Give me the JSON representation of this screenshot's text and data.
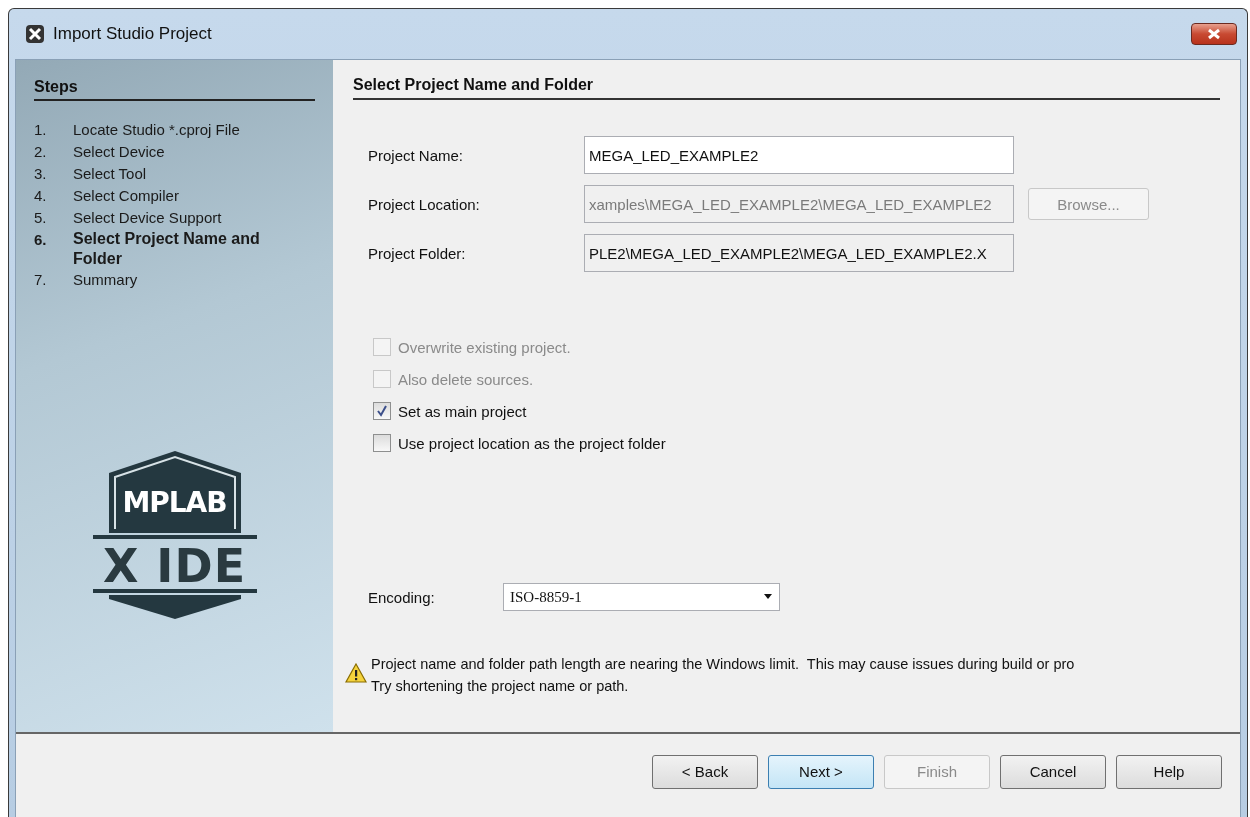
{
  "window": {
    "title": "Import Studio Project"
  },
  "steps": {
    "heading": "Steps",
    "items": [
      {
        "number": "1.",
        "label": "Locate Studio *.cproj File",
        "selected": false
      },
      {
        "number": "2.",
        "label": "Select Device",
        "selected": false
      },
      {
        "number": "3.",
        "label": "Select Tool",
        "selected": false
      },
      {
        "number": "4.",
        "label": "Select Compiler",
        "selected": false
      },
      {
        "number": "5.",
        "label": "Select Device Support",
        "selected": false
      },
      {
        "number": "6.",
        "label": "Select Project Name and Folder",
        "selected": true
      },
      {
        "number": "7.",
        "label": "Summary",
        "selected": false
      }
    ]
  },
  "logo": {
    "top": "MPLAB",
    "bottom": "X IDE"
  },
  "panel": {
    "title": "Select Project Name and Folder",
    "fields": [
      {
        "label": "Project Name:",
        "value": "MEGA_LED_EXAMPLE2",
        "disabled": false
      },
      {
        "label": "Project Location:",
        "value": "xamples\\MEGA_LED_EXAMPLE2\\MEGA_LED_EXAMPLE2",
        "disabled": true,
        "button": {
          "label": "Browse...",
          "disabled": true
        }
      },
      {
        "label": "Project Folder:",
        "value": "PLE2\\MEGA_LED_EXAMPLE2\\MEGA_LED_EXAMPLE2.X",
        "disabled": true
      }
    ],
    "checkboxes": [
      {
        "label": "Overwrite existing project.",
        "checked": false,
        "disabled": true
      },
      {
        "label": "Also delete sources.",
        "checked": false,
        "disabled": true
      },
      {
        "label": "Set as main project",
        "checked": true,
        "disabled": false
      },
      {
        "label": "Use project location as the project folder",
        "checked": false,
        "disabled": false
      }
    ],
    "encoding": {
      "label": "Encoding:",
      "value": "ISO-8859-1"
    },
    "warning": [
      "Project name and folder path length are nearing the Windows limit.  This may cause issues during build or pro",
      "Try shortening the project name or path."
    ]
  },
  "buttons": [
    {
      "label": "< Back",
      "disabled": false,
      "default": false
    },
    {
      "label": "Next >",
      "disabled": false,
      "default": true
    },
    {
      "label": "Finish",
      "disabled": true,
      "default": false
    },
    {
      "label": "Cancel",
      "disabled": false,
      "default": false
    },
    {
      "label": "Help",
      "disabled": false,
      "default": false
    }
  ]
}
